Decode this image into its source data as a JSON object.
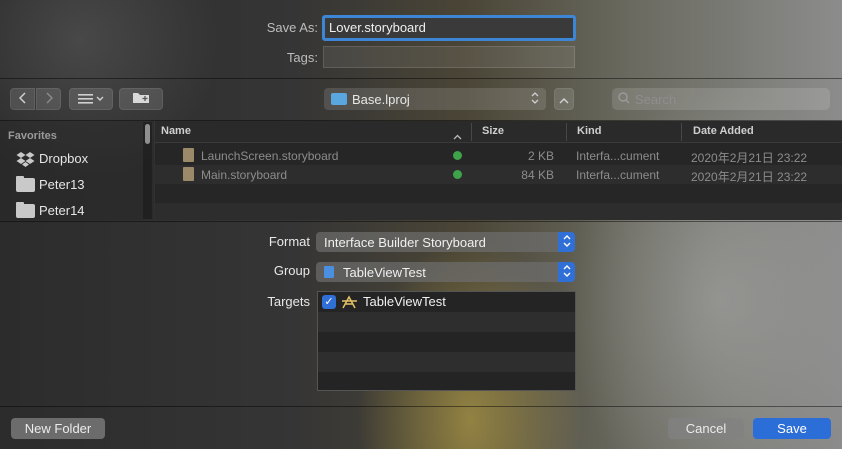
{
  "save_as": {
    "label": "Save As:",
    "value": "Lover.storyboard"
  },
  "tags": {
    "label": "Tags:",
    "value": ""
  },
  "toolbar": {
    "back_icon": "chevron-left",
    "forward_icon": "chevron-right",
    "view_icon": "list-view",
    "new_folder_icon": "folder-plus",
    "location": "Base.lproj",
    "search_placeholder": "Search"
  },
  "sidebar": {
    "section": "Favorites",
    "items": [
      {
        "label": "Dropbox",
        "icon": "dropbox"
      },
      {
        "label": "Peter13",
        "icon": "folder"
      },
      {
        "label": "Peter14",
        "icon": "folder"
      }
    ]
  },
  "table": {
    "columns": [
      "Name",
      "Size",
      "Kind",
      "Date Added"
    ],
    "rows": [
      {
        "name": "LaunchScreen.storyboard",
        "size": "2 KB",
        "kind": "Interfa...cument",
        "date": "2020年2月21日 23:22"
      },
      {
        "name": "Main.storyboard",
        "size": "84 KB",
        "kind": "Interfa...cument",
        "date": "2020年2月21日 23:22"
      }
    ]
  },
  "form": {
    "format_label": "Format",
    "format_value": "Interface Builder Storyboard",
    "group_label": "Group",
    "group_value": "TableViewTest",
    "targets_label": "Targets",
    "targets": [
      {
        "label": "TableViewTest",
        "checked": true
      }
    ]
  },
  "buttons": {
    "new_folder": "New Folder",
    "cancel": "Cancel",
    "save": "Save"
  },
  "colors": {
    "accent": "#2c6ed8",
    "status_ok": "#3fa34a"
  }
}
